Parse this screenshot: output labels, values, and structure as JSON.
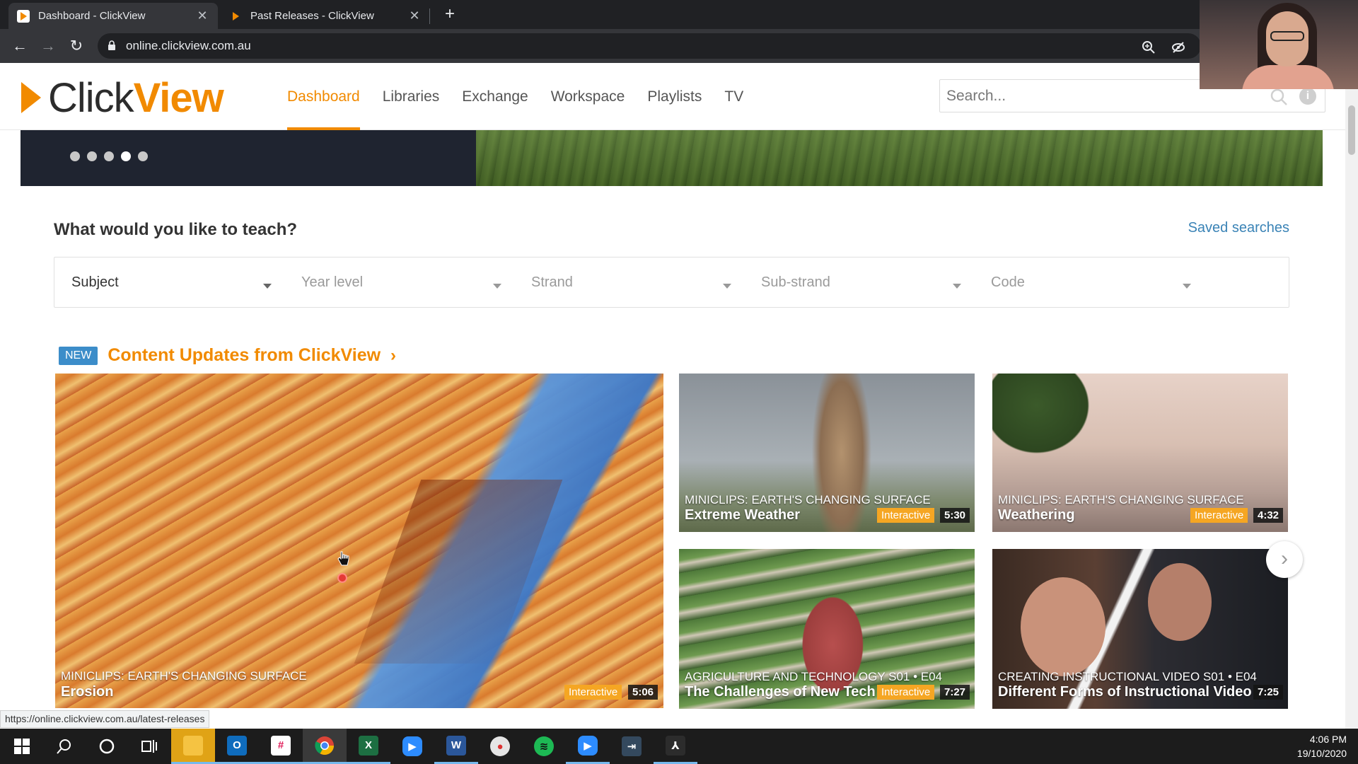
{
  "browser": {
    "tabs": [
      {
        "title": "Dashboard - ClickView",
        "active": true
      },
      {
        "title": "Past Releases - ClickView",
        "active": false
      }
    ],
    "url": "online.clickview.com.au"
  },
  "header": {
    "logo": {
      "part1": "Click",
      "part2": "View"
    },
    "nav": [
      "Dashboard",
      "Libraries",
      "Exchange",
      "Workspace",
      "Playlists",
      "TV"
    ],
    "active_nav": "Dashboard",
    "search_placeholder": "Search..."
  },
  "banner": {
    "slide_count": 5,
    "active_slide": 4
  },
  "teach": {
    "title": "What would you like to teach?",
    "saved_searches": "Saved searches",
    "filters": [
      "Subject",
      "Year level",
      "Strand",
      "Sub-strand",
      "Code"
    ]
  },
  "updates": {
    "badge": "NEW",
    "title": "Content Updates from ClickView",
    "cards": [
      {
        "series": "MINICLIPS: EARTH'S CHANGING SURFACE",
        "title": "Erosion",
        "tag": "Interactive",
        "duration": "5:06"
      },
      {
        "series": "MINICLIPS: EARTH'S CHANGING SURFACE",
        "title": "Extreme Weather",
        "tag": "Interactive",
        "duration": "5:30"
      },
      {
        "series": "MINICLIPS: EARTH'S CHANGING SURFACE",
        "title": "Weathering",
        "tag": "Interactive",
        "duration": "4:32"
      },
      {
        "series": "AGRICULTURE AND TECHNOLOGY  S01 • E04",
        "title": "The Challenges of New Tech",
        "tag": "Interactive",
        "duration": "7:27"
      },
      {
        "series": "CREATING INSTRUCTIONAL VIDEO  S01 • E04",
        "title": "Different Forms of Instructional Video",
        "tag": "",
        "duration": "7:25"
      }
    ]
  },
  "status_url": "https://online.clickview.com.au/latest-releases",
  "taskbar": {
    "time": "4:06 PM",
    "date": "19/10/2020"
  }
}
